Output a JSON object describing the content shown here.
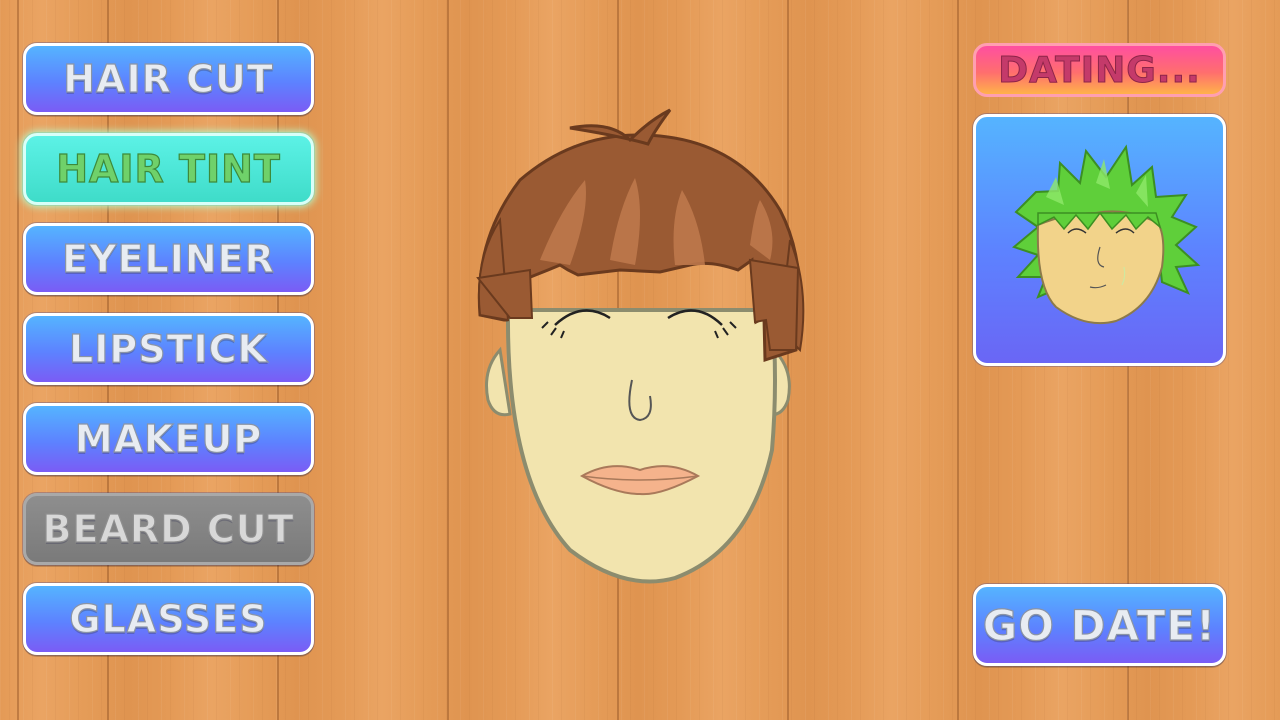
{
  "menu": {
    "hair_cut": "HAIR CUT",
    "hair_tint": "HAIR TINT",
    "eyeliner": "EYELINER",
    "lipstick": "LIPSTICK",
    "makeup": "MAKEUP",
    "beard_cut": "BEARD CUT",
    "glasses": "GLASSES"
  },
  "status": {
    "dating": "DATING..."
  },
  "actions": {
    "go_date": "GO DATE!"
  },
  "colors": {
    "button_blue": "#5d82ff",
    "button_active_teal": "#3fdcc9",
    "button_disabled_gray": "#7f7f7f",
    "dating_pink": "#ff6e6e",
    "wood": "#e49b57",
    "hair_brown": "#9a5a33",
    "date_hair_green": "#5fcf3a",
    "skin": "#f2e4ae"
  }
}
